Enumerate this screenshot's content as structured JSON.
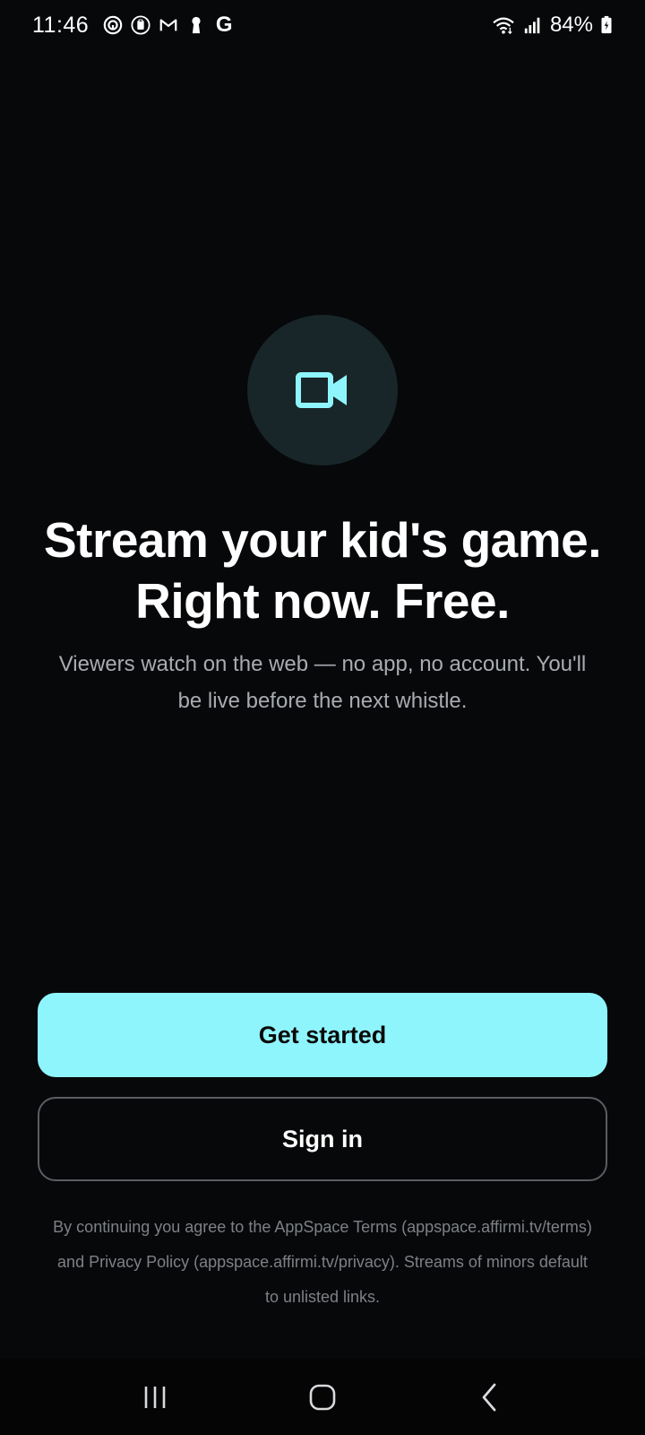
{
  "status_bar": {
    "time": "11:46",
    "notification_icons": [
      "podcast-icon",
      "clipboard-icon",
      "gmail-icon",
      "keyhole-icon",
      "google-icon"
    ],
    "google_letter": "G",
    "battery_percent": "84%"
  },
  "hero": {
    "icon": "video-camera-icon",
    "headline_line1": "Stream your kid's game.",
    "headline_line2": "Right now. Free.",
    "subtitle": "Viewers watch on the web — no app, no account. You'll be live before the next whistle."
  },
  "actions": {
    "primary_label": "Get started",
    "secondary_label": "Sign in"
  },
  "legal": {
    "text": "By continuing you agree to the AppSpace Terms (appspace.affirmi.tv/terms) and Privacy Policy (appspace.affirmi.tv/privacy). Streams of minors default to unlisted links."
  },
  "colors": {
    "background": "#07080a",
    "accent": "#8ff5fd",
    "icon_circle": "#18262a",
    "subtitle_text": "#a8abb0",
    "legal_text": "#7d8085"
  },
  "nav_bar": {
    "buttons": [
      "recent-apps-icon",
      "home-icon",
      "back-icon"
    ]
  }
}
